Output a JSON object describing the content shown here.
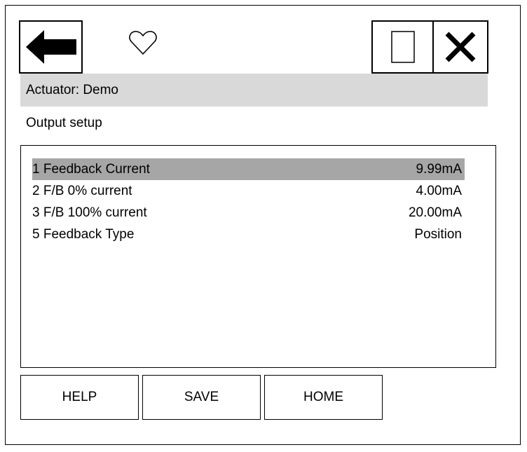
{
  "header": {
    "actuator_label": "Actuator: Demo",
    "screen_title": "Output setup"
  },
  "toolbar": {
    "back_icon": "arrow-left-icon",
    "favorite_icon": "heart-outline-icon",
    "window_icon": "window-icon",
    "close_icon": "close-icon"
  },
  "items": [
    {
      "label": "1 Feedback Current",
      "value": "9.99mA",
      "selected": true
    },
    {
      "label": "2 F/B 0% current",
      "value": "4.00mA",
      "selected": false
    },
    {
      "label": "3 F/B 100% current",
      "value": "20.00mA",
      "selected": false
    },
    {
      "label": "5 Feedback Type",
      "value": "Position",
      "selected": false
    }
  ],
  "buttons": {
    "help": "HELP",
    "save": "SAVE",
    "home": "HOME"
  },
  "colors": {
    "titlebar_bg": "#d9d9d9",
    "selected_row_bg": "#a6a6a6"
  }
}
